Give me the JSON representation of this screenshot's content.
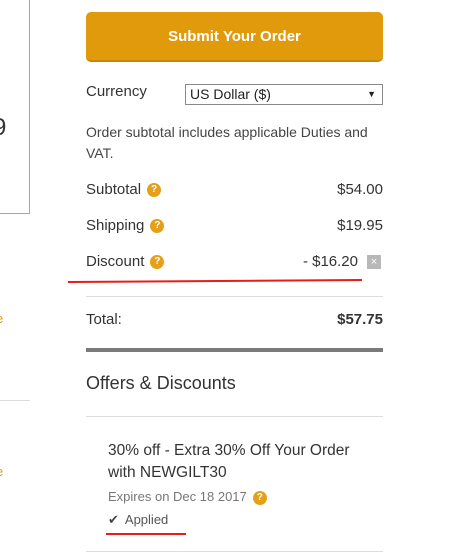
{
  "left_panel": {
    "glyph": "9",
    "link_1": "e",
    "link_2": "e"
  },
  "order": {
    "submit_label": "Submit Your Order",
    "currency_label": "Currency",
    "currency_value": "US Dollar ($)",
    "note": "Order subtotal includes applicable Duties and VAT.",
    "subtotal_label": "Subtotal",
    "subtotal_value": "$54.00",
    "shipping_label": "Shipping",
    "shipping_value": "$19.95",
    "discount_label": "Discount",
    "discount_value": "- $16.20",
    "total_label": "Total:",
    "total_value": "$57.75",
    "help_glyph": "?",
    "remove_glyph": "×"
  },
  "offers": {
    "section_title": "Offers & Discounts",
    "items": [
      {
        "title": "30% off - Extra 30% Off Your Order with NEWGILT30",
        "expires": "Expires on Dec 18 2017",
        "status": "Applied"
      }
    ]
  },
  "colors": {
    "accent": "#e09a0c",
    "annotation": "#e81c1c"
  },
  "icons": {
    "help": "question-circle-icon",
    "remove": "close-icon",
    "check": "checkmark-icon",
    "dropdown": "chevron-down-icon"
  }
}
